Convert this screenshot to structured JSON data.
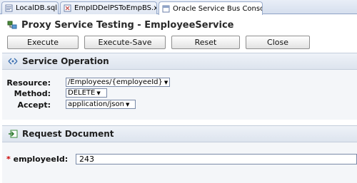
{
  "tabs": [
    {
      "label": "LocalDB.sql"
    },
    {
      "label": "EmpIDDelPSToEmpBS.xqy"
    },
    {
      "label": "Oracle Service Bus Consol..."
    }
  ],
  "title": "Proxy Service Testing - EmployeeService",
  "toolbar": {
    "execute": "Execute",
    "execute_save": "Execute-Save",
    "reset": "Reset",
    "close": "Close"
  },
  "service_operation": {
    "header": "Service Operation",
    "resource_label": "Resource:",
    "resource_value": "/Employees/{employeeId}",
    "method_label": "Method:",
    "method_value": "DELETE",
    "accept_label": "Accept:",
    "accept_value": "application/json"
  },
  "request_document": {
    "header": "Request Document",
    "required_marker": "*",
    "employee_label": "employeeId:",
    "employee_value": "243"
  },
  "colors": {
    "tab_border": "#9aaccc",
    "section_bg": "#f4f6f9",
    "required": "#cc0000"
  }
}
